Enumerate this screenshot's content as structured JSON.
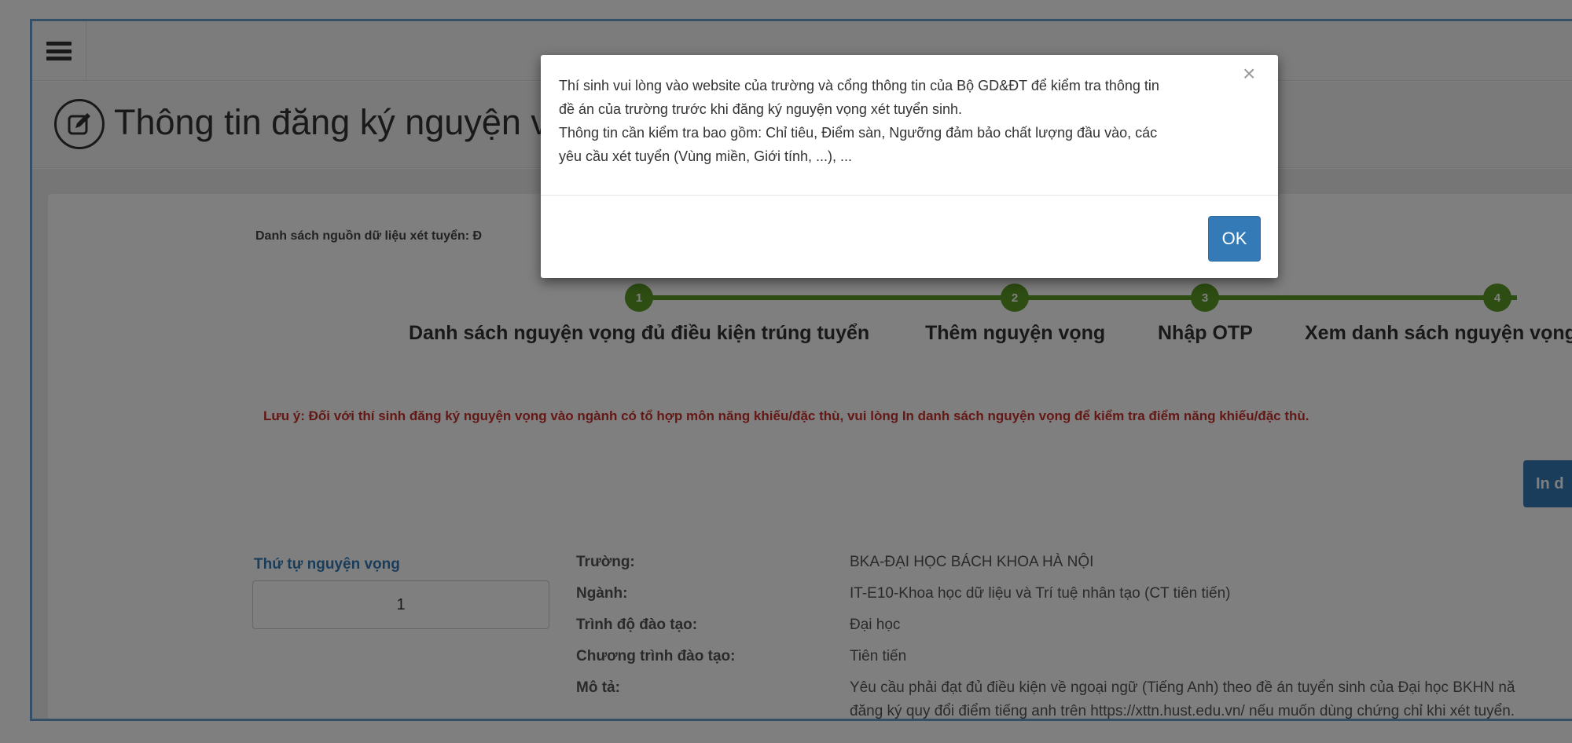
{
  "header": {
    "title": "Thông tin đăng ký nguyện vọng"
  },
  "main": {
    "sources_label": "Danh sách nguồn dữ liệu xét tuyển: Đ",
    "steps": [
      {
        "number": "1",
        "label": "Danh sách nguyện vọng đủ điều kiện trúng tuyển"
      },
      {
        "number": "2",
        "label": "Thêm nguyện vọng"
      },
      {
        "number": "3",
        "label": "Nhập OTP"
      },
      {
        "number": "4",
        "label": "Xem danh sách nguyện vọng"
      }
    ],
    "note": "Lưu ý: Đối với thí sinh đăng ký nguyện vọng vào ngành có tổ hợp môn năng khiếu/đặc thù, vui lòng In danh sách nguyện vọng để kiểm tra điểm năng khiếu/đặc thù.",
    "print_button": "In d",
    "order_label": "Thứ tự nguyện vọng",
    "order_value": "1",
    "details": [
      {
        "label": "Trường:",
        "value": "BKA-ĐẠI HỌC BÁCH KHOA HÀ NỘI"
      },
      {
        "label": "Ngành:",
        "value": "IT-E10-Khoa học dữ liệu và Trí tuệ nhân tạo (CT tiên tiến)"
      },
      {
        "label": "Trình độ đào tạo:",
        "value": "Đại học"
      },
      {
        "label": "Chương trình đào tạo:",
        "value": "Tiên tiến"
      },
      {
        "label": "Mô tả:",
        "value": "Yêu cầu phải đạt đủ điều kiện về ngoại ngữ (Tiếng Anh) theo đề án tuyển sinh của Đại học BKHN nă"
      }
    ],
    "description_line2": "đăng ký quy đổi điểm tiếng anh trên https://xttn.hust.edu.vn/ nếu muốn dùng chứng chỉ khi xét tuyển."
  },
  "modal": {
    "line1": "Thí sinh vui lòng vào website của trường và cổng thông tin của Bộ GD&ĐT để kiểm tra thông tin",
    "line2": "đề án của trường trước khi đăng ký nguyện vọng xét tuyển sinh.",
    "line3": "Thông tin cần kiểm tra bao gồm: Chỉ tiêu, Điểm sàn, Ngưỡng đảm bảo chất lượng đầu vào, các",
    "line4": "yêu cầu xét tuyển (Vùng miền, Giới tính, ...), ...",
    "close": "×",
    "ok": "OK"
  },
  "colors": {
    "accent": "#337ab7",
    "step": "#5a9a24",
    "warning": "#c9302c"
  }
}
